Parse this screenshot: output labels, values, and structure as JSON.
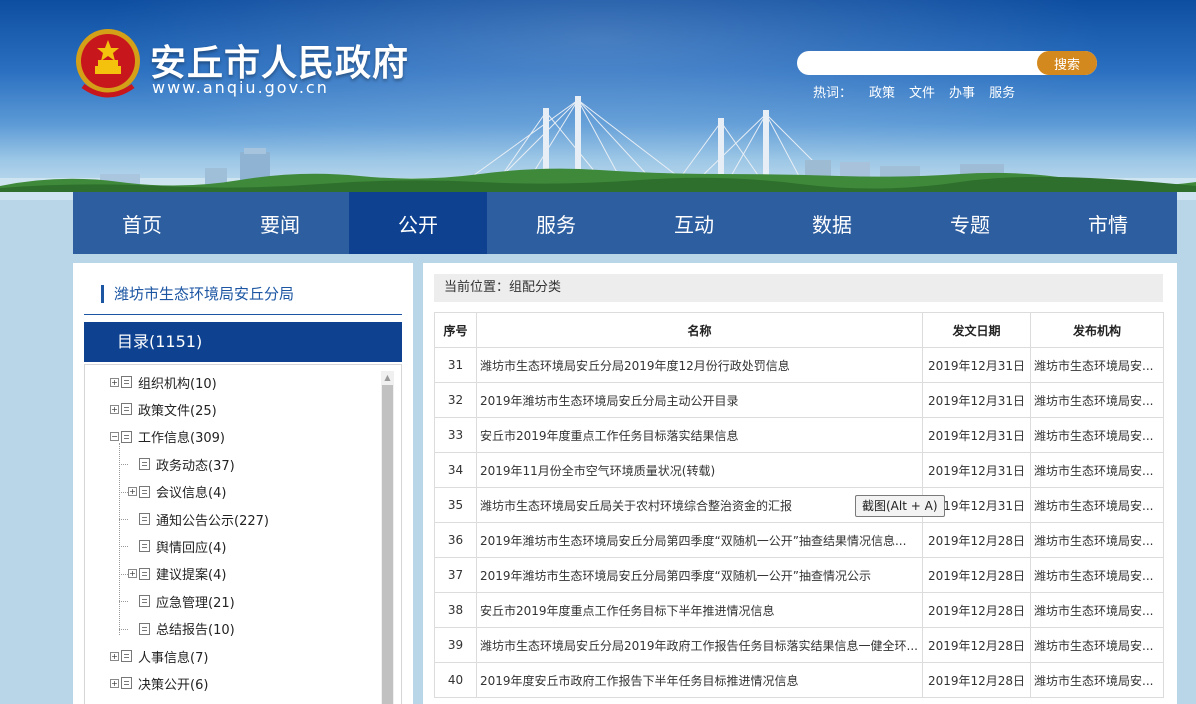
{
  "site": {
    "title": "安丘市人民政府",
    "url": "www.anqiu.gov.cn"
  },
  "search": {
    "placeholder": "",
    "button_label": "搜索"
  },
  "hotwords": {
    "label": "热词：",
    "items": [
      "政策",
      "文件",
      "办事",
      "服务"
    ]
  },
  "nav": {
    "items": [
      "首页",
      "要闻",
      "公开",
      "服务",
      "互动",
      "数据",
      "专题",
      "市情"
    ],
    "active_index": 2
  },
  "sidebar": {
    "dept_title": "潍坊市生态环境局安丘分局",
    "catalog_label": "目录(1151)",
    "tree": [
      {
        "label": "组织机构(10)",
        "level": 0,
        "toggle": "+"
      },
      {
        "label": "政策文件(25)",
        "level": 0,
        "toggle": "+"
      },
      {
        "label": "工作信息(309)",
        "level": 0,
        "toggle": "-"
      },
      {
        "label": "政务动态(37)",
        "level": 1,
        "toggle": ""
      },
      {
        "label": "会议信息(4)",
        "level": 1,
        "toggle": "+"
      },
      {
        "label": "通知公告公示(227)",
        "level": 1,
        "toggle": ""
      },
      {
        "label": "舆情回应(4)",
        "level": 1,
        "toggle": ""
      },
      {
        "label": "建议提案(4)",
        "level": 1,
        "toggle": "+"
      },
      {
        "label": "应急管理(21)",
        "level": 1,
        "toggle": ""
      },
      {
        "label": "总结报告(10)",
        "level": 1,
        "toggle": ""
      },
      {
        "label": "人事信息(7)",
        "level": 0,
        "toggle": "+"
      },
      {
        "label": "决策公开(6)",
        "level": 0,
        "toggle": "+"
      }
    ]
  },
  "breadcrumb": {
    "label": "当前位置：",
    "current": "组配分类"
  },
  "table": {
    "headers": [
      "序号",
      "名称",
      "发文日期",
      "发布机构"
    ],
    "rows": [
      {
        "no": "31",
        "name": "潍坊市生态环境局安丘分局2019年度12月份行政处罚信息",
        "date": "2019年12月31日",
        "org": "潍坊市生态环境局安..."
      },
      {
        "no": "32",
        "name": "2019年潍坊市生态环境局安丘分局主动公开目录",
        "date": "2019年12月31日",
        "org": "潍坊市生态环境局安..."
      },
      {
        "no": "33",
        "name": "安丘市2019年度重点工作任务目标落实结果信息",
        "date": "2019年12月31日",
        "org": "潍坊市生态环境局安..."
      },
      {
        "no": "34",
        "name": "2019年11月份全市空气环境质量状况(转载)",
        "date": "2019年12月31日",
        "org": "潍坊市生态环境局安..."
      },
      {
        "no": "35",
        "name": "潍坊市生态环境局安丘局关于农村环境综合整治资金的汇报",
        "date": "2019年12月31日",
        "org": "潍坊市生态环境局安..."
      },
      {
        "no": "36",
        "name": "2019年潍坊市生态环境局安丘分局第四季度“双随机一公开”抽查结果情况信息...",
        "date": "2019年12月28日",
        "org": "潍坊市生态环境局安..."
      },
      {
        "no": "37",
        "name": "2019年潍坊市生态环境局安丘分局第四季度“双随机一公开”抽查情况公示",
        "date": "2019年12月28日",
        "org": "潍坊市生态环境局安..."
      },
      {
        "no": "38",
        "name": "安丘市2019年度重点工作任务目标下半年推进情况信息",
        "date": "2019年12月28日",
        "org": "潍坊市生态环境局安..."
      },
      {
        "no": "39",
        "name": "潍坊市生态环境局安丘分局2019年政府工作报告任务目标落实结果信息一健全环...",
        "date": "2019年12月28日",
        "org": "潍坊市生态环境局安..."
      },
      {
        "no": "40",
        "name": "2019年度安丘市政府工作报告下半年任务目标推进情况信息",
        "date": "2019年12月28日",
        "org": "潍坊市生态环境局安..."
      }
    ]
  },
  "tooltip": {
    "text": "截图(Alt + A)"
  },
  "colors": {
    "nav_bg": "#2d5e9f",
    "nav_active": "#0e4290",
    "accent_orange": "#d4891e",
    "page_bg": "#b8d6e8"
  }
}
